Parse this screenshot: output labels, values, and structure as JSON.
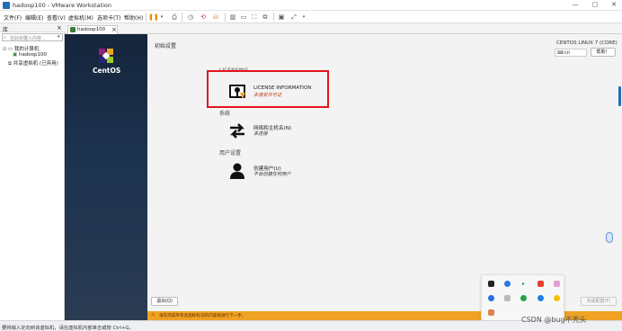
{
  "window": {
    "title": "hadoop100 - VMware Workstation",
    "controls": {
      "minimize": "—",
      "maximize": "▢",
      "close": "✕"
    }
  },
  "menu": {
    "items": [
      "文件(F)",
      "编辑(E)",
      "查看(V)",
      "虚拟机(M)",
      "选项卡(T)",
      "帮助(H)"
    ]
  },
  "library": {
    "header": "库",
    "close_glyph": "×",
    "search_placeholder": "在此处键入内容...",
    "tree": [
      {
        "label": "我的计算机",
        "level": 0
      },
      {
        "label": "hadoop100",
        "level": 1
      },
      {
        "label": "共享虚拟机 (已弃用)",
        "level": 0
      }
    ]
  },
  "tab": {
    "label": "hadoop100",
    "close_glyph": "×"
  },
  "centos": {
    "logo_text": "CentOS",
    "page_title": "初始设置",
    "product": "CENTOS LINUX 7 (CORE)",
    "keyboard": "cn",
    "help_button": "帮助！",
    "sections": [
      {
        "category": "LICENSING",
        "spokes": [
          {
            "title": "LICENSE INFORMATION",
            "status": "未接受许可证",
            "icon": "license-icon",
            "warn": true
          }
        ]
      },
      {
        "category": "系统",
        "spokes": [
          {
            "title": "网络和主机名(N)",
            "status": "未连接",
            "icon": "network-icon",
            "warn": false
          }
        ]
      },
      {
        "category": "用户设置",
        "spokes": [
          {
            "title": "创建用户(U)",
            "status": "不会创建任何用户",
            "icon": "user-icon",
            "warn": false
          }
        ]
      }
    ],
    "quit_button": "退出(Q)",
    "finish_button": "完成配置(F)",
    "warning_text": "请先完成带有此图标标记的内容再进行下一步。"
  },
  "statusbar": {
    "text": "要将输入定向到该虚拟机，请在虚拟机内部单击或按 Ctrl+G。"
  },
  "watermark": "CSDN @bug不秃头",
  "colors": {
    "highlight": "#e2141c",
    "warning_bar": "#f0a224",
    "sidebar_dark": "#15253c"
  }
}
